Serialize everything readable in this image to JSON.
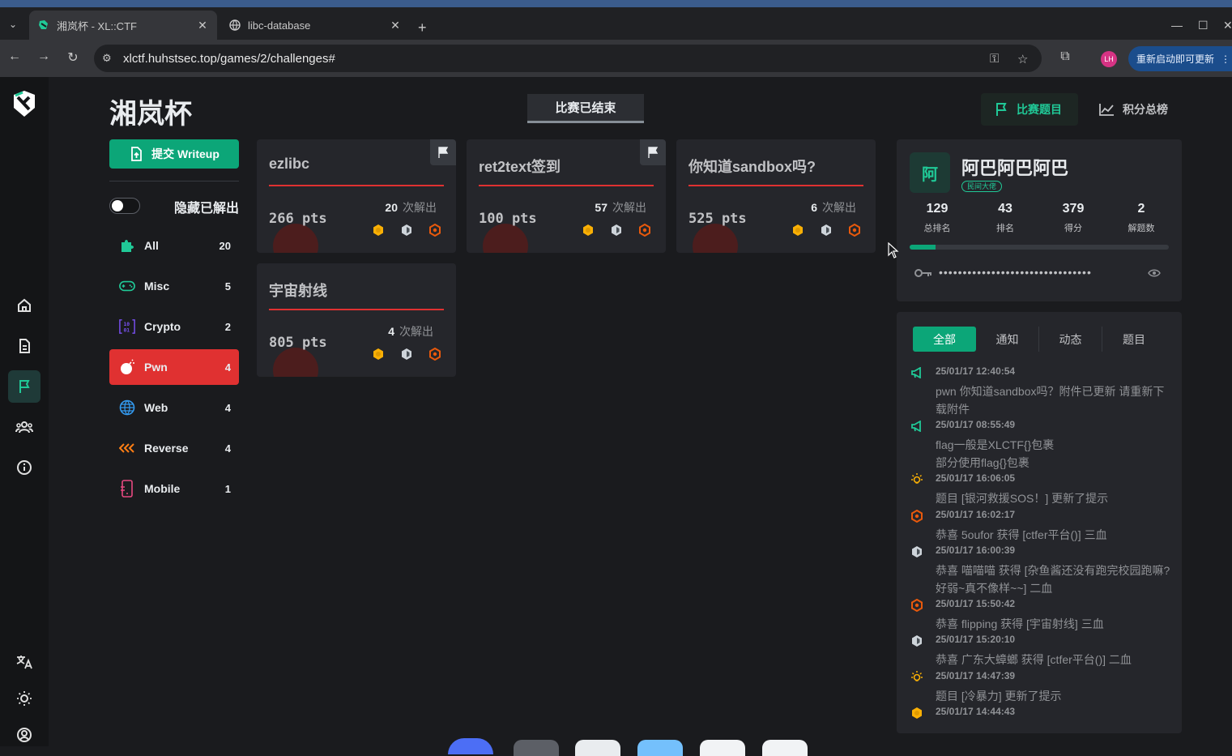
{
  "browser": {
    "tabs": [
      {
        "title": "湘岚杯 - XL::CTF",
        "active": true,
        "close": "✕"
      },
      {
        "title": "libc-database",
        "active": false,
        "close": "✕"
      }
    ],
    "new_tab": "+",
    "url": "xlctf.huhstsec.top/games/2/challenges#",
    "profile_initials": "LH",
    "update_label": "重新启动即可更新"
  },
  "header": {
    "title": "湘岚杯",
    "status": "比赛已结束",
    "nav": [
      {
        "label": "比赛题目",
        "icon": "flag-icon",
        "active": true
      },
      {
        "label": "积分总榜",
        "icon": "chart-line-icon",
        "active": false
      }
    ]
  },
  "sidebar": {
    "writeup_label": "提交 Writeup",
    "hide_solved_label": "隐藏已解出",
    "hide_solved_on": false,
    "categories": [
      {
        "name": "All",
        "count": "20",
        "icon": "puzzle-icon",
        "color": "#20c997",
        "active": false
      },
      {
        "name": "Misc",
        "count": "5",
        "icon": "gamepad-icon",
        "color": "#20c997",
        "active": false
      },
      {
        "name": "Crypto",
        "count": "2",
        "icon": "binary-icon",
        "color": "#7950f2",
        "active": false
      },
      {
        "name": "Pwn",
        "count": "4",
        "icon": "bomb-icon",
        "color": "#ffffff",
        "active": true
      },
      {
        "name": "Web",
        "count": "4",
        "icon": "globe-icon",
        "color": "#339af0",
        "active": false
      },
      {
        "name": "Reverse",
        "count": "4",
        "icon": "chevrons-left-icon",
        "color": "#fd7e14",
        "active": false
      },
      {
        "name": "Mobile",
        "count": "1",
        "icon": "phone-icon",
        "color": "#e64980",
        "active": false
      }
    ]
  },
  "challenges": [
    {
      "name": "ezlibc",
      "points": "266 pts",
      "solves": "20",
      "solves_label": "次解出",
      "flagged": true
    },
    {
      "name": "ret2text签到",
      "points": "100 pts",
      "solves": "57",
      "solves_label": "次解出",
      "flagged": true
    },
    {
      "name": "你知道sandbox吗?",
      "points": "525 pts",
      "solves": "6",
      "solves_label": "次解出",
      "flagged": false
    },
    {
      "name": "宇宙射线",
      "points": "805 pts",
      "solves": "4",
      "solves_label": "次解出",
      "flagged": false
    }
  ],
  "medal_colors": {
    "gold": "#fab005",
    "silver": "#ced4da",
    "bronze": "#e8590c"
  },
  "profile": {
    "avatar_char": "阿",
    "name": "阿巴阿巴阿巴",
    "badge": "民间大佬",
    "stats": [
      {
        "value": "129",
        "label": "总排名"
      },
      {
        "value": "43",
        "label": "排名"
      },
      {
        "value": "379",
        "label": "得分"
      },
      {
        "value": "2",
        "label": "解题数"
      }
    ],
    "progress_fraction": 0.1,
    "token_mask": "••••••••••••••••••••••••••••••••"
  },
  "feed": {
    "tabs": [
      "全部",
      "通知",
      "动态",
      "题目"
    ],
    "active_tab": 0,
    "entries": [
      {
        "icon": "megaphone-icon",
        "time": "25/01/17 12:40:54",
        "text": "pwn 你知道sandbox吗？附件已更新 请重新下载附件"
      },
      {
        "icon": "megaphone-icon",
        "time": "25/01/17 08:55:49",
        "text": "flag一般是XLCTF{}包裹\n部分使用flag{}包裹"
      },
      {
        "icon": "bulb-icon",
        "time": "25/01/17 16:06:05",
        "text": "题目 [银河救援SOS！] 更新了提示"
      },
      {
        "icon": "bronze-medal-icon",
        "time": "25/01/17 16:02:17",
        "text": "恭喜 5oufor 获得 [ctfer平台()] 三血"
      },
      {
        "icon": "silver-medal-icon",
        "time": "25/01/17 16:00:39",
        "text": "恭喜 喵喵喵 获得 [杂鱼酱还没有跑完校园跑嘛?好弱~真不像样~~] 二血"
      },
      {
        "icon": "bronze-medal-icon",
        "time": "25/01/17 15:50:42",
        "text": "恭喜 flipping 获得 [宇宙射线] 三血"
      },
      {
        "icon": "silver-medal-icon",
        "time": "25/01/17 15:20:10",
        "text": "恭喜 广东大蟑螂 获得 [ctfer平台()] 二血"
      },
      {
        "icon": "bulb-icon",
        "time": "25/01/17 14:47:39",
        "text": "题目 [冷暴力] 更新了提示"
      },
      {
        "icon": "gold-medal-icon",
        "time": "25/01/17 14:44:43",
        "text": ""
      }
    ]
  }
}
